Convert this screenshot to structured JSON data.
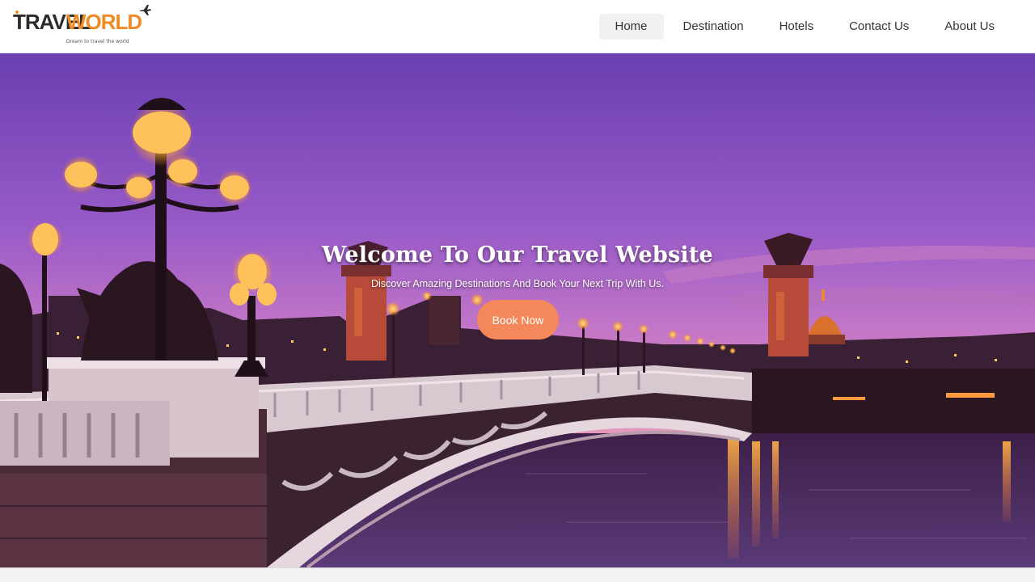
{
  "brand": {
    "name_part1": "TRAVEL",
    "name_part2": "WORLD",
    "tagline": "Dream to travel the world"
  },
  "nav": {
    "items": [
      {
        "label": "Home",
        "active": true
      },
      {
        "label": "Destination",
        "active": false
      },
      {
        "label": "Hotels",
        "active": false
      },
      {
        "label": "Contact Us",
        "active": false
      },
      {
        "label": "About Us",
        "active": false
      }
    ]
  },
  "hero": {
    "title": "Welcome To Our Travel Website",
    "subtitle": "Discover Amazing Destinations And Book Your Next Trip With Us.",
    "cta_label": "Book Now"
  },
  "colors": {
    "accent": "#f4885a",
    "brand_orange": "#f08a24",
    "brand_dark": "#2c2c2c",
    "sky_top": "#6a3fb0",
    "sky_bottom": "#e28ac2"
  },
  "icons": {
    "logo_plane": "airplane-icon"
  }
}
